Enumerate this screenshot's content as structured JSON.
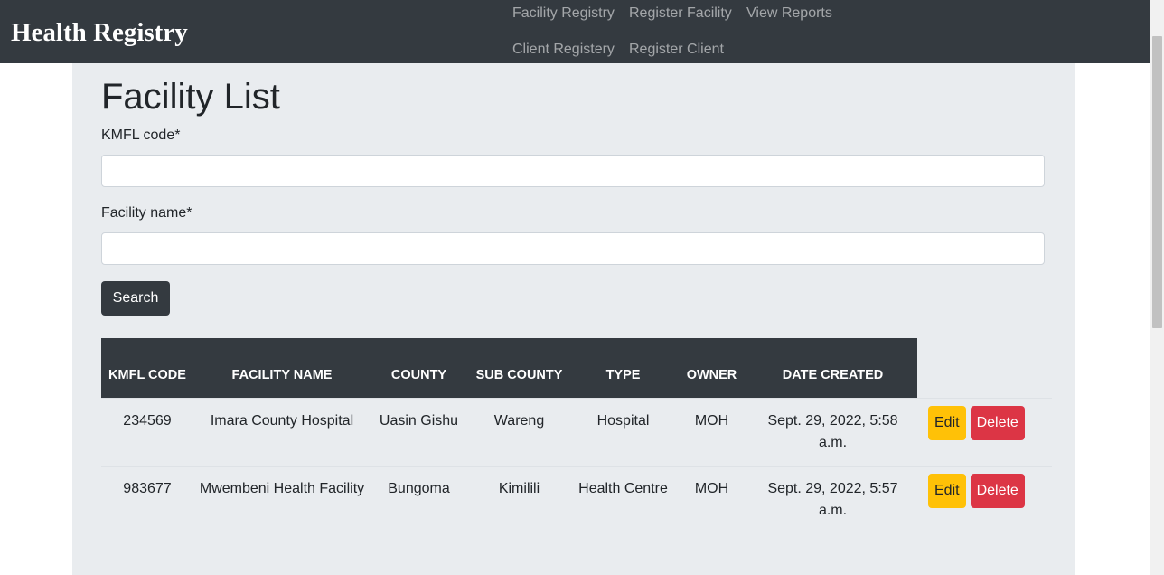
{
  "nav": {
    "brand": "Health Registry",
    "links": [
      "Facility Registry",
      "Register Facility",
      "View Reports",
      "Client Registery",
      "Register Client"
    ]
  },
  "page": {
    "title": "Facility List",
    "kmfl_label": "KMFL code*",
    "kmfl_value": "",
    "name_label": "Facility name*",
    "name_value": "",
    "search_label": "Search"
  },
  "table": {
    "headers": [
      "KMFL CODE",
      "FACILITY NAME",
      "COUNTY",
      "SUB COUNTY",
      "TYPE",
      "OWNER",
      "DATE CREATED"
    ],
    "rows": [
      {
        "kmfl": "234569",
        "name": "Imara County Hospital",
        "county": "Uasin Gishu",
        "sub_county": "Wareng",
        "type": "Hospital",
        "owner": "MOH",
        "date": "Sept. 29, 2022, 5:58 a.m."
      },
      {
        "kmfl": "983677",
        "name": "Mwembeni Health Facility",
        "county": "Bungoma",
        "sub_county": "Kimilili",
        "type": "Health Centre",
        "owner": "MOH",
        "date": "Sept. 29, 2022, 5:57 a.m."
      }
    ],
    "edit_label": "Edit",
    "delete_label": "Delete"
  },
  "colors": {
    "navbar": "#343a40",
    "container": "#e9ecef",
    "edit": "#ffc107",
    "delete": "#dc3545"
  }
}
